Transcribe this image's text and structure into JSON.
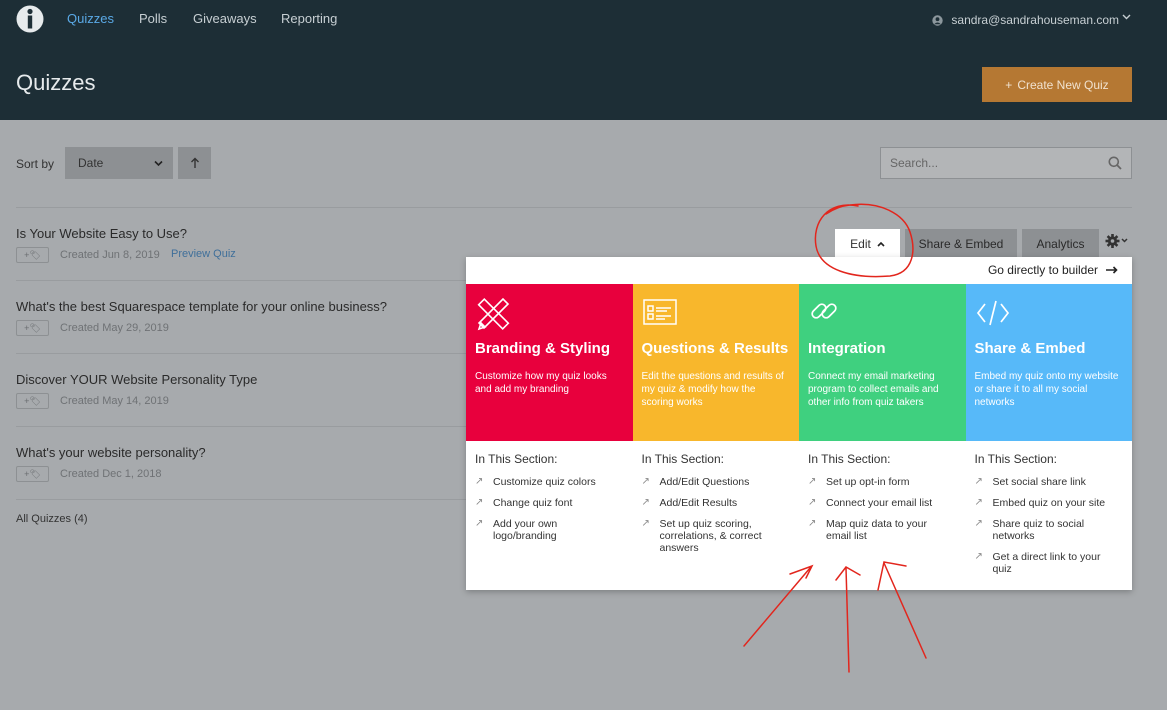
{
  "nav": {
    "links": [
      "Quizzes",
      "Polls",
      "Giveaways",
      "Reporting"
    ],
    "user_email": "sandra@sandrahouseman.com"
  },
  "header": {
    "title": "Quizzes",
    "create_label": "Create New Quiz"
  },
  "toolbar": {
    "sort_label": "Sort by",
    "sort_value": "Date",
    "search_placeholder": "Search..."
  },
  "quizzes": [
    {
      "title": "Is Your Website Easy to Use?",
      "created": "Created Jun 8, 2019",
      "preview": "Preview Quiz"
    },
    {
      "title": "What's the best Squarespace template for your online business?",
      "created": "Created May 29, 2019"
    },
    {
      "title": "Discover YOUR Website Personality Type",
      "created": "Created May 14, 2019"
    },
    {
      "title": "What's your website personality?",
      "created": "Created Dec 1, 2018"
    }
  ],
  "all_quizzes": "All Quizzes (4)",
  "actions": {
    "edit": "Edit",
    "share": "Share & Embed",
    "analytics": "Analytics"
  },
  "panel": {
    "goto_label": "Go directly to builder",
    "section_heading": "In This Section:",
    "cards": [
      {
        "title": "Branding & Styling",
        "desc": "Customize how my quiz looks and add my branding",
        "color": "#e8003d",
        "icon": "pencil-ruler-icon",
        "items": [
          "Customize quiz colors",
          "Change quiz font",
          "Add your own logo/branding"
        ]
      },
      {
        "title": "Questions & Results",
        "desc": "Edit the questions and results of my quiz & modify how the scoring works",
        "color": "#f8b72c",
        "icon": "form-icon",
        "items": [
          "Add/Edit Questions",
          "Add/Edit Results",
          "Set up quiz scoring, correlations, & correct answers"
        ]
      },
      {
        "title": "Integration",
        "desc": "Connect my email marketing program to collect emails and other info from quiz takers",
        "color": "#3fd07f",
        "icon": "link-icon",
        "items": [
          "Set up opt-in form",
          "Connect your email list",
          "Map quiz data to your email list"
        ]
      },
      {
        "title": "Share & Embed",
        "desc": "Embed my quiz onto my website or share it to all my social networks",
        "color": "#57b9f9",
        "icon": "code-icon",
        "items": [
          "Set social share link",
          "Embed quiz on your site",
          "Share quiz to social networks",
          "Get a direct link to your quiz"
        ]
      }
    ]
  },
  "colors": {
    "topbar": "#1d2e36",
    "accent": "#b57833",
    "annotation": "#e2261d"
  }
}
